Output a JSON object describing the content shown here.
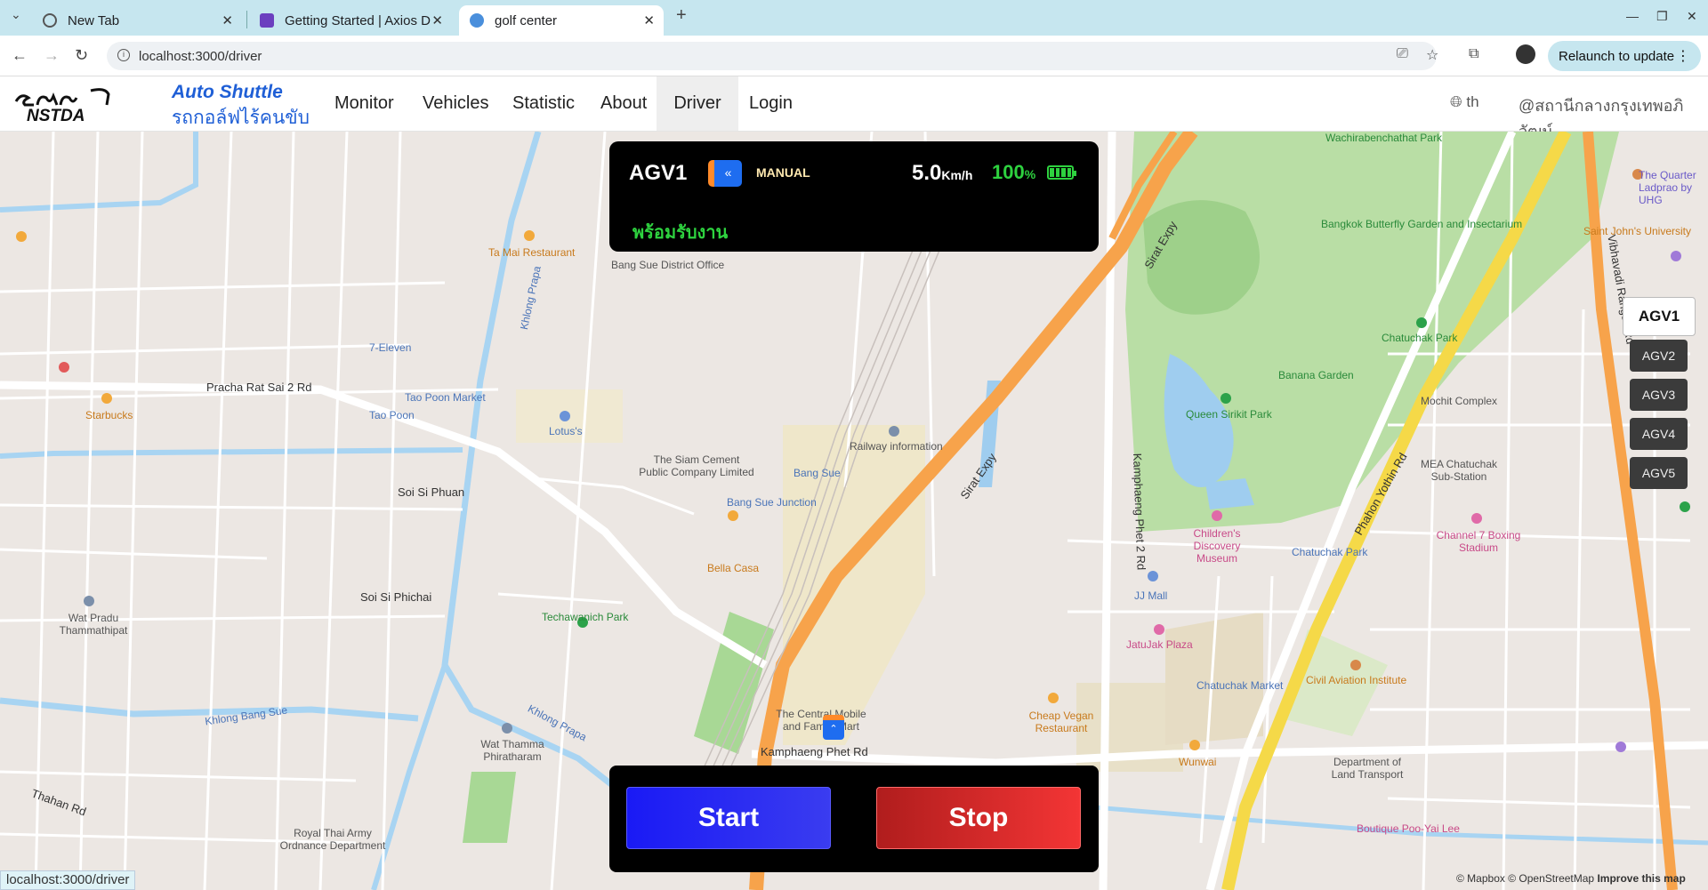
{
  "browser": {
    "tabs": [
      {
        "title": "New Tab"
      },
      {
        "title": "Getting Started | Axios D"
      },
      {
        "title": "golf center"
      }
    ],
    "url": "localhost:3000/driver",
    "relaunch_label": "Relaunch to update",
    "status_url": "localhost:3000/driver"
  },
  "app": {
    "brand_title": "Auto Shuttle",
    "brand_subtitle": "รถกอล์ฟไร้คนขับ",
    "nav": [
      "Monitor",
      "Vehicles",
      "Statistic",
      "About",
      "Driver",
      "Login"
    ],
    "active_nav": "Driver",
    "language": "th",
    "station": "@สถานีกลางกรุงเทพอภิวัฒน์"
  },
  "vehicle_panel": {
    "name": "AGV1",
    "direction_glyph": "«",
    "mode": "MANUAL",
    "speed": "5.0",
    "speed_unit": "Km/h",
    "battery": "100",
    "battery_unit": "%",
    "status": "พร้อมรับงาน"
  },
  "vehicles": [
    "AGV1",
    "AGV2",
    "AGV3",
    "AGV4",
    "AGV5"
  ],
  "active_vehicle": "AGV1",
  "controls": {
    "start": "Start",
    "stop": "Stop"
  },
  "map": {
    "labels": {
      "wachira": "Wachirabenchathat Park",
      "butterfly": "Bangkok Butterfly Garden and Insectarium",
      "chatuchak_park": "Chatuchak Park",
      "banana": "Banana Garden",
      "sirikit": "Queen Sirikit Park",
      "bang_sue": "Bang Sue",
      "bang_sue_junction": "Bang Sue Junction",
      "railway_info": "Railway information",
      "siam_cement": "The Siam Cement Public Company Limited",
      "pracha_rat": "Pracha Rat Sai 2 Rd",
      "kamphaeng": "Kamphaeng Phet Rd",
      "sirat": "Sirat Expy",
      "tao_poon": "Tao Poon",
      "tao_poon_market": "Tao Poon Market",
      "lotus": "Lotus's",
      "seven_eleven": "7-Eleven",
      "starbucks": "Starbucks",
      "tai_mai": "Ta Mai Restaurant",
      "district": "Bang Sue District Office",
      "bella": "Bella Casa",
      "techawanich": "Techawanich Park",
      "jj_mall": "JJ Mall",
      "jatujak": "JatuJak Plaza",
      "chatuchak_market": "Chatuchak Market",
      "civil_aviation": "Civil Aviation Institute",
      "land_transport": "Department of Land Transport",
      "children_museum": "Children's Discovery Museum",
      "channel7": "Channel 7 Boxing Stadium",
      "mea": "MEA Chatuchak Sub-Station",
      "mochit": "Mochit Complex",
      "saint_john": "Saint John's University",
      "quarter": "The Quarter Ladprao by UHG",
      "wat_thamma": "Wat Thamma Phiratharam",
      "wat_pradu": "Wat Pradu Thammathipat",
      "royal_thai": "Royal Thai Army Ordnance Department",
      "boutique": "Boutique Poo-Yai Lee",
      "khlong_prapa": "Khlong Prapa",
      "khlong_bang_sue": "Khlong Bang Sue",
      "vibhavadi": "Vibhavadi Rangsit Rd",
      "phahon": "Phahon Yothin Rd",
      "thahan": "Thahan Rd",
      "kamphaeng2": "Kamphaeng Phet 2 Rd",
      "central": "The Central Mobile and Family Mart",
      "cheap_vegan": "Cheap Vegan Restaurant",
      "wunwai": "Wunwai",
      "soi_si_phuan": "Soi Si Phuan",
      "soi_si_phichai": "Soi Si Phichai",
      "chatuchak_park_stn": "Chatuchak Park"
    },
    "attribution_mapbox": "© Mapbox",
    "attribution_osm": "© OpenStreetMap",
    "attribution_improve": "Improve this map"
  },
  "colors": {
    "accent_blue": "#1f5fd6",
    "start": "#1a1af5",
    "stop": "#e02a2a",
    "ok_green": "#2ed23f"
  }
}
